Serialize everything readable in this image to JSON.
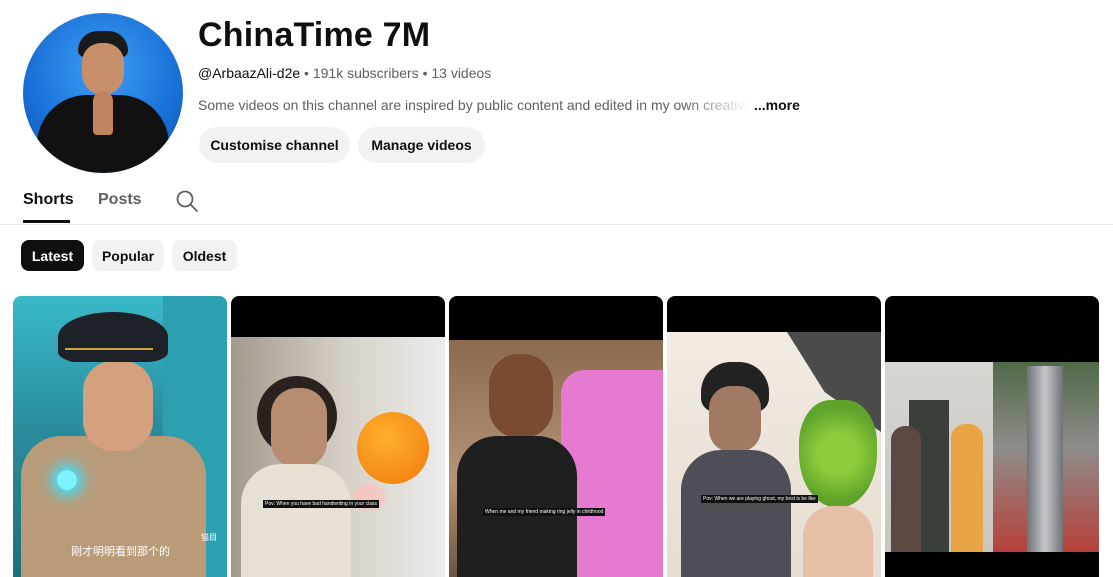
{
  "channel": {
    "name": "ChinaTime 7M",
    "handle": "@ArbaazAli-d2e",
    "subscribers": "191k subscribers",
    "videos": "13 videos",
    "separator": "•",
    "description": "Some videos on this channel are inspired by public content and edited in my own creative",
    "more_label": "...more"
  },
  "actions": {
    "customise_label": "Customise channel",
    "manage_label": "Manage videos"
  },
  "tabs": [
    {
      "label": "Shorts",
      "active": true
    },
    {
      "label": "Posts",
      "active": false
    }
  ],
  "filters": [
    {
      "label": "Latest",
      "active": true
    },
    {
      "label": "Popular",
      "active": false
    },
    {
      "label": "Oldest",
      "active": false
    }
  ],
  "shorts": [
    {
      "subtitle": "刚才明明看到那个的",
      "watermark": "猫目"
    },
    {
      "caption": "Pov: When you have bad handwriting in your class"
    },
    {
      "caption": "When me and my friend making ring jelly in childhood"
    },
    {
      "caption": "Pov: When we are playing ghost, my best is be like"
    },
    {}
  ],
  "icons": {
    "search": "search-icon"
  }
}
